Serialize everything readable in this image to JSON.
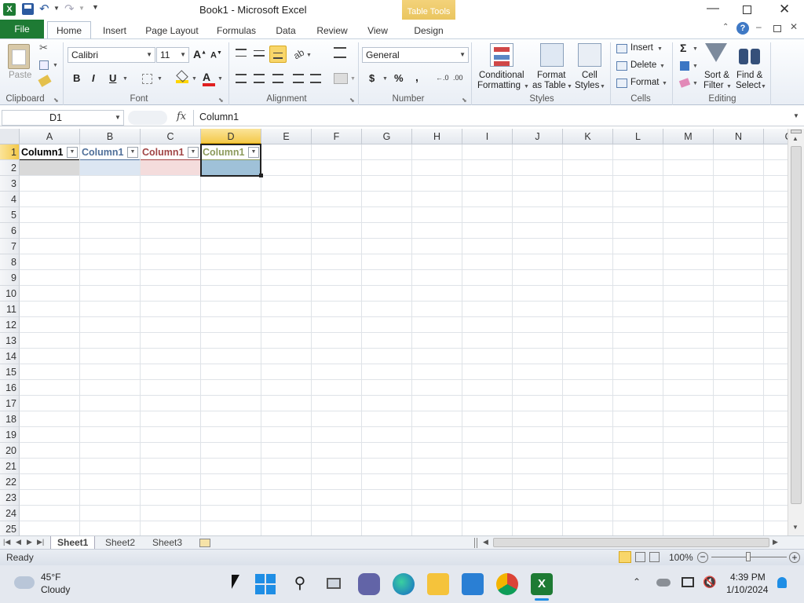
{
  "window": {
    "title": "Book1  -  Microsoft Excel",
    "contextual_tab": "Table Tools"
  },
  "tabs": {
    "file": "File",
    "home": "Home",
    "insert": "Insert",
    "page_layout": "Page Layout",
    "formulas": "Formulas",
    "data": "Data",
    "review": "Review",
    "view": "View",
    "design": "Design"
  },
  "ribbon": {
    "clipboard": {
      "paste": "Paste",
      "label": "Clipboard"
    },
    "font": {
      "name": "Calibri",
      "size": "11",
      "bold": "B",
      "italic": "I",
      "underline": "U",
      "label": "Font"
    },
    "alignment": {
      "label": "Alignment"
    },
    "number": {
      "format": "General",
      "currency": "$",
      "percent": "%",
      "comma": ",",
      "label": "Number"
    },
    "styles": {
      "conditional_1": "Conditional",
      "conditional_2": "Formatting",
      "format_table_1": "Format",
      "format_table_2": "as Table",
      "cell_styles_1": "Cell",
      "cell_styles_2": "Styles",
      "label": "Styles"
    },
    "cells": {
      "insert": "Insert",
      "delete": "Delete",
      "format": "Format",
      "label": "Cells"
    },
    "editing": {
      "sum": "Σ",
      "sort_1": "Sort &",
      "sort_2": "Filter",
      "find_1": "Find &",
      "find_2": "Select",
      "label": "Editing"
    }
  },
  "formula_bar": {
    "name_box": "D1",
    "fx": "fx",
    "content": "Column1"
  },
  "grid": {
    "columns": [
      "A",
      "B",
      "C",
      "D",
      "E",
      "F",
      "G",
      "H",
      "I",
      "J",
      "K",
      "L",
      "M",
      "N",
      "O"
    ],
    "rows": [
      "1",
      "2",
      "3",
      "4",
      "5",
      "6",
      "7",
      "8",
      "9",
      "10",
      "11",
      "12",
      "13",
      "14",
      "15",
      "16",
      "17",
      "18",
      "19",
      "20",
      "21",
      "22",
      "23",
      "24",
      "25"
    ],
    "table_headers": [
      {
        "text": "Column1",
        "color": "#000000",
        "band": "#d9d9d9"
      },
      {
        "text": "Column1",
        "color": "#4f6f99",
        "band": "#dce6f2"
      },
      {
        "text": "Column1",
        "color": "#a14545",
        "band": "#f4dcdc"
      },
      {
        "text": "Column1",
        "color": "#8c9a5b",
        "band": "#9fc1d8"
      }
    ]
  },
  "sheets": {
    "tabs": [
      "Sheet1",
      "Sheet2",
      "Sheet3"
    ],
    "active": "Sheet1"
  },
  "status": {
    "mode": "Ready",
    "zoom": "100%"
  },
  "taskbar": {
    "weather_temp": "45°F",
    "weather_desc": "Cloudy",
    "time": "4:39 PM",
    "date": "1/10/2024"
  },
  "colors": {
    "excel_green": "#1e7b34",
    "selection_header": "#f9d65f",
    "table_tools": "#e8c35a"
  }
}
